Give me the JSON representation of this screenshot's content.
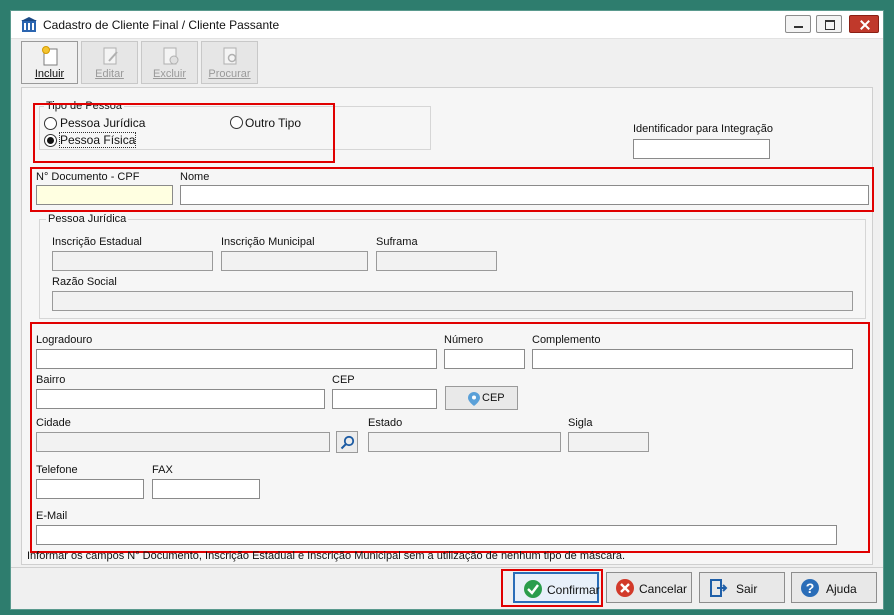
{
  "window": {
    "title": "Cadastro de Cliente Final / Cliente Passante"
  },
  "toolbar": {
    "incluir": "Incluir",
    "editar": "Editar",
    "excluir": "Excluir",
    "procurar": "Procurar"
  },
  "tipo_pessoa": {
    "legend": "Tipo de Pessoa",
    "juridica": "Pessoa Jurídica",
    "fisica": "Pessoa Física",
    "outro": "Outro Tipo",
    "selected": "Pessoa Física"
  },
  "identificador": {
    "label": "Identificador para Integração",
    "value": ""
  },
  "documento": {
    "label": "N° Documento - CPF",
    "value": ""
  },
  "nome": {
    "label": "Nome",
    "value": ""
  },
  "pessoa_juridica": {
    "legend": "Pessoa Jurídica",
    "inscricao_estadual": "Inscrição Estadual",
    "inscricao_municipal": "Inscrição Municipal",
    "suframa": "Suframa",
    "razao_social": "Razão Social"
  },
  "endereco": {
    "logradouro": "Logradouro",
    "numero": "Número",
    "complemento": "Complemento",
    "bairro": "Bairro",
    "cep": "CEP",
    "cep_button": "CEP",
    "cidade": "Cidade",
    "estado": "Estado",
    "sigla": "Sigla",
    "telefone": "Telefone",
    "fax": "FAX",
    "email": "E-Mail"
  },
  "note": "Informar os campos N° Documento, Inscrição Estadual e Inscrição Municipal sem a utilização de nenhum tipo de máscara.",
  "footer": {
    "confirmar": "Confirmar",
    "cancelar": "Cancelar",
    "sair": "Sair",
    "ajuda": "Ajuda"
  },
  "colors": {
    "highlight": "#e00000",
    "background": "#2e7d6e",
    "required_field": "#ffffe1"
  }
}
